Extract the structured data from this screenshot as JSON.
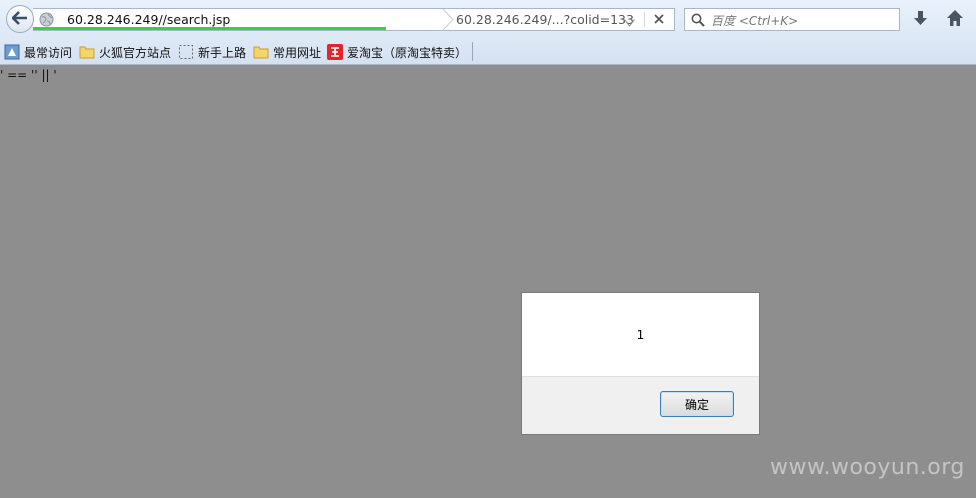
{
  "browser": {
    "url": "60.28.246.249//search.jsp",
    "autocomplete": "60.28.246.249/...?colid=133",
    "search_placeholder": "百度 <Ctrl+K>",
    "load_progress": 0.55,
    "accent_color": "#3fce3f"
  },
  "bookmarks": [
    {
      "label": "最常访问",
      "icon": "most-visited-icon"
    },
    {
      "label": "火狐官方站点",
      "icon": "folder-icon"
    },
    {
      "label": "新手上路",
      "icon": "dashed-page-icon"
    },
    {
      "label": "常用网址",
      "icon": "folder-icon"
    },
    {
      "label": "爱淘宝（原淘宝特卖）",
      "icon": "taobao-icon"
    }
  ],
  "page": {
    "text": "' == '' || '"
  },
  "alert": {
    "message": "1",
    "ok_label": "确定"
  },
  "watermark": "www.wooyun.org"
}
